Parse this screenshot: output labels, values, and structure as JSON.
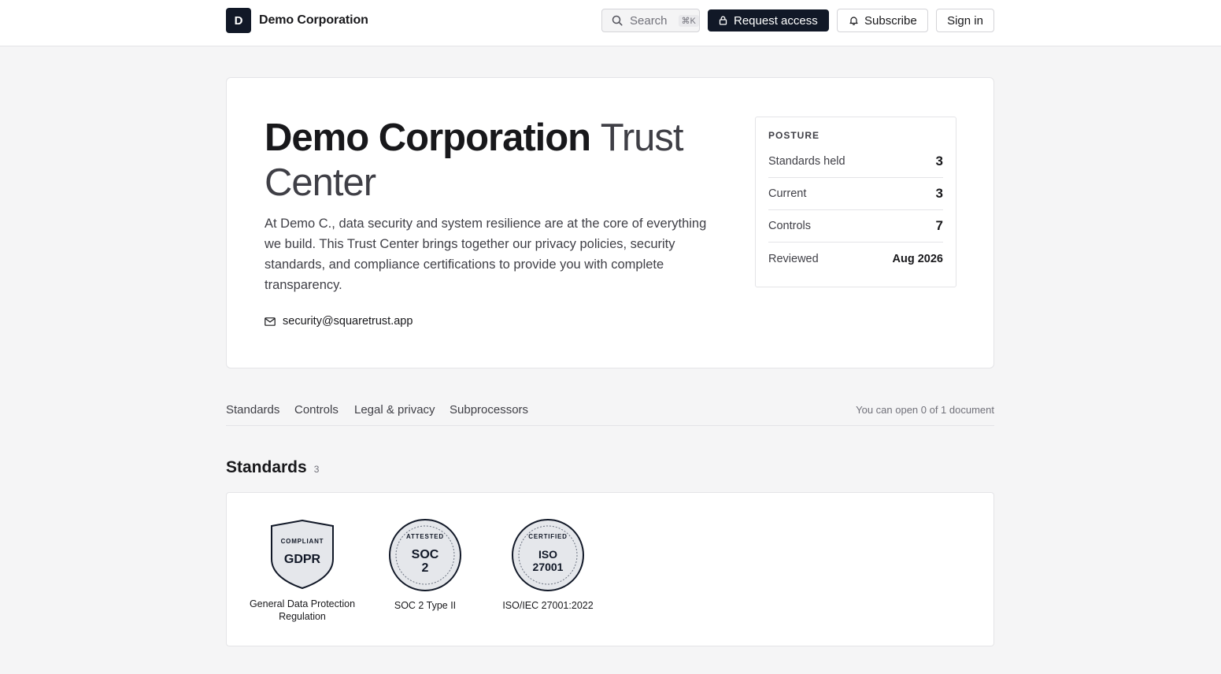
{
  "header": {
    "logo_letter": "D",
    "brand_name": "Demo Corporation",
    "search_label": "Search",
    "search_shortcut": "⌘K",
    "request_access_label": "Request access",
    "subscribe_label": "Subscribe",
    "sign_in_label": "Sign in"
  },
  "hero": {
    "title_strong": "Demo Corporation",
    "title_light": "Trust Center",
    "description": "At Demo C., data security and system resilience are at the core of everything we build. This Trust Center brings together our privacy policies, security standards, and compliance certifications to provide you with complete transparency.",
    "email": "security@squaretrust.app"
  },
  "posture": {
    "heading": "POSTURE",
    "rows": [
      {
        "label": "Standards held",
        "value": "3"
      },
      {
        "label": "Current",
        "value": "3"
      },
      {
        "label": "Controls",
        "value": "7"
      },
      {
        "label": "Reviewed",
        "value": "Aug 2026"
      }
    ]
  },
  "tabs": {
    "items": [
      "Standards",
      "Controls",
      "Legal & privacy",
      "Subprocessors"
    ],
    "documents_note": "You can open 0 of 1 document"
  },
  "standards": {
    "title": "Standards",
    "count": "3",
    "items": [
      {
        "badge_top": "COMPLIANT",
        "badge_main": "GDPR",
        "caption": "General Data Protection Regulation"
      },
      {
        "badge_top": "ATTESTED",
        "badge_main_1": "SOC",
        "badge_main_2": "2",
        "caption": "SOC 2 Type II"
      },
      {
        "badge_top": "CERTIFIED",
        "badge_main_1": "ISO",
        "badge_main_2": "27001",
        "caption": "ISO/IEC 27001:2022"
      }
    ]
  },
  "colors": {
    "primary": "#111827",
    "background": "#f5f5f6",
    "badge_fill": "#e5e7eb"
  }
}
